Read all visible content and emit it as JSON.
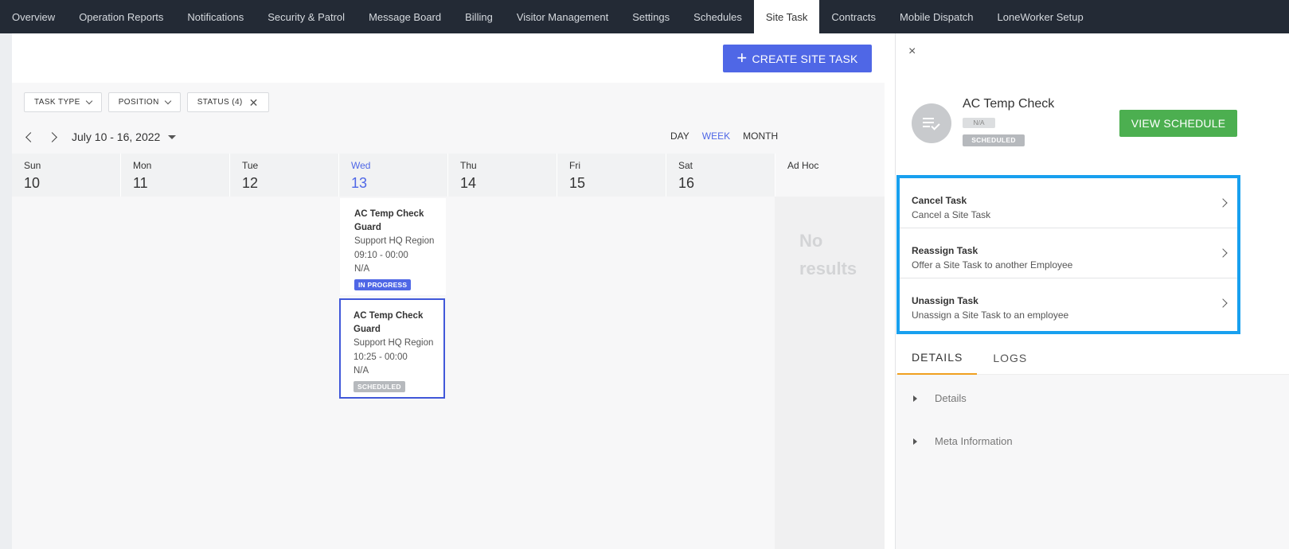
{
  "nav": {
    "tabs": [
      "Overview",
      "Operation Reports",
      "Notifications",
      "Security & Patrol",
      "Message Board",
      "Billing",
      "Visitor Management",
      "Settings",
      "Schedules",
      "Site Task",
      "Contracts",
      "Mobile Dispatch",
      "LoneWorker Setup"
    ],
    "active": "Site Task"
  },
  "toolbar": {
    "create_label": "CREATE SITE TASK"
  },
  "filters": {
    "task_type": "TASK TYPE",
    "position": "POSITION",
    "status": "STATUS (4)"
  },
  "calendar": {
    "date_range": "July 10 - 16, 2022",
    "views": {
      "day": "DAY",
      "week": "WEEK",
      "month": "MONTH"
    },
    "days": [
      {
        "name": "Sun",
        "num": "10"
      },
      {
        "name": "Mon",
        "num": "11"
      },
      {
        "name": "Tue",
        "num": "12"
      },
      {
        "name": "Wed",
        "num": "13"
      },
      {
        "name": "Thu",
        "num": "14"
      },
      {
        "name": "Fri",
        "num": "15"
      },
      {
        "name": "Sat",
        "num": "16"
      }
    ],
    "adhoc_label": "Ad Hoc",
    "no_results_1": "No",
    "no_results_2": "results"
  },
  "tasks": [
    {
      "title": "AC Temp Check",
      "position": "Guard",
      "region": "Support HQ Region",
      "time": "09:10 - 00:00",
      "extra": "N/A",
      "status": "IN PROGRESS"
    },
    {
      "title": "AC Temp Check",
      "position": "Guard",
      "region": "Support HQ Region",
      "time": "10:25 - 00:00",
      "extra": "N/A",
      "status": "SCHEDULED"
    }
  ],
  "panel": {
    "close": "×",
    "title": "AC Temp Check",
    "badge_na": "N/A",
    "badge_status": "SCHEDULED",
    "view_schedule": "VIEW SCHEDULE",
    "actions": [
      {
        "title": "Cancel Task",
        "subtitle": "Cancel a Site Task"
      },
      {
        "title": "Reassign Task",
        "subtitle": "Offer a Site Task to another Employee"
      },
      {
        "title": "Unassign Task",
        "subtitle": "Unassign a Site Task to an employee"
      }
    ],
    "tabs": {
      "details": "DETAILS",
      "logs": "LOGS"
    },
    "sections": {
      "details": "Details",
      "meta": "Meta Information"
    }
  },
  "colors": {
    "accent": "#4f67e6",
    "nav_bg": "#232a35",
    "success": "#4caf50",
    "highlight": "#18a0ef",
    "tab_underline": "#f0a020"
  }
}
